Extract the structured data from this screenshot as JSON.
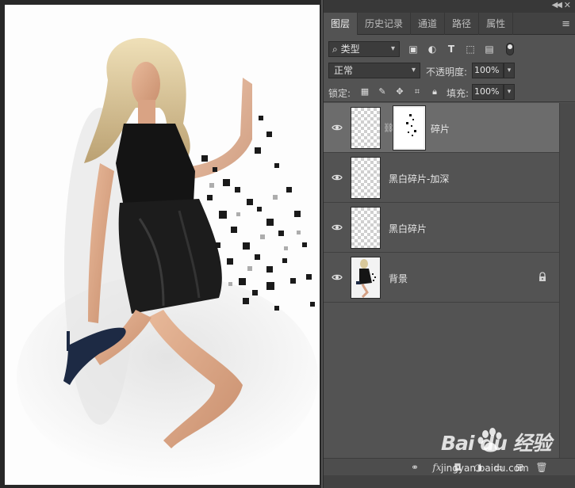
{
  "panel": {
    "tabs": [
      {
        "label": "图层",
        "active": true
      },
      {
        "label": "历史记录",
        "active": false
      },
      {
        "label": "通道",
        "active": false
      },
      {
        "label": "路径",
        "active": false
      },
      {
        "label": "属性",
        "active": false
      }
    ],
    "topbar": {
      "collapse_icon": "double-chevron-icon",
      "close_icon": "close-icon"
    },
    "filter": {
      "value": "类型",
      "icon": "search-icon"
    },
    "blend_mode": {
      "value": "正常"
    },
    "opacity": {
      "label": "不透明度:",
      "value": "100%"
    },
    "lock": {
      "label": "锁定:"
    },
    "fill": {
      "label": "填充:",
      "value": "100%"
    },
    "layers": [
      {
        "name": "碎片",
        "visible": true,
        "selected": true,
        "has_mask": true,
        "locked": false
      },
      {
        "name": "黑白碎片-加深",
        "visible": true,
        "selected": false,
        "has_mask": false,
        "locked": false
      },
      {
        "name": "黑白碎片",
        "visible": true,
        "selected": false,
        "has_mask": false,
        "locked": false
      },
      {
        "name": "背景",
        "visible": true,
        "selected": false,
        "has_mask": false,
        "locked": true
      }
    ],
    "bottom_icons": [
      "link-icon",
      "fx-icon",
      "mask-icon",
      "adjustment-icon",
      "folder-icon",
      "new-layer-icon",
      "trash-icon"
    ]
  },
  "watermark": {
    "logo_text": "Bai du 经验",
    "url": "jingyan.baidu.com"
  },
  "colors": {
    "panel_bg": "#535353",
    "selected_layer": "#6c6c6c",
    "tab_bar": "#424242"
  }
}
